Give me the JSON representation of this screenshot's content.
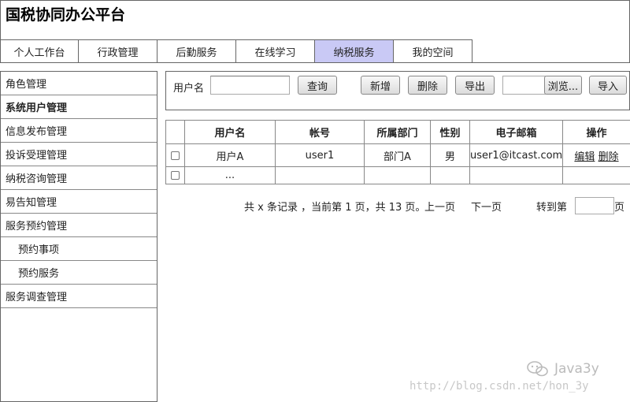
{
  "header": {
    "title": "国税协同办公平台"
  },
  "nav": {
    "tabs": [
      {
        "label": "个人工作台"
      },
      {
        "label": "行政管理"
      },
      {
        "label": "后勤服务"
      },
      {
        "label": "在线学习"
      },
      {
        "label": "纳税服务",
        "active": true
      },
      {
        "label": "我的空间"
      }
    ]
  },
  "sidebar": {
    "items": [
      {
        "label": "角色管理"
      },
      {
        "label": "系统用户管理",
        "active": true
      },
      {
        "label": "信息发布管理"
      },
      {
        "label": "投诉受理管理"
      },
      {
        "label": "纳税咨询管理"
      },
      {
        "label": "易告知管理"
      },
      {
        "label": "服务预约管理"
      },
      {
        "label": "预约事项",
        "sub": true
      },
      {
        "label": "预约服务",
        "sub": true
      },
      {
        "label": "服务调查管理"
      }
    ]
  },
  "search": {
    "label": "用户名",
    "value": "",
    "query_button": "查询",
    "add_button": "新增",
    "delete_button": "删除",
    "export_button": "导出",
    "browse_button": "浏览...",
    "import_button": "导入"
  },
  "table": {
    "headers": [
      "",
      "用户名",
      "帐号",
      "所属部门",
      "性别",
      "电子邮箱",
      "操作"
    ],
    "rows": [
      {
        "username": "用户A",
        "account": "user1",
        "dept": "部门A",
        "gender": "男",
        "email": "user1@itcast.com",
        "edit": "编辑",
        "delete": "删除"
      },
      {
        "username": "...",
        "account": "",
        "dept": "",
        "gender": "",
        "email": "",
        "edit": "",
        "delete": ""
      }
    ]
  },
  "pager": {
    "summary": "共 x 条记录 ，当前第 1 页，共 13 页。",
    "prev": "上一页",
    "next": "下一页",
    "goto_label": "转到第",
    "page_suffix": "页",
    "goto_value": ""
  },
  "watermark": {
    "url": "http://blog.csdn.net/hon_3y",
    "brand": "Java3y"
  },
  "colors": {
    "active_tab": "#c9c9f5",
    "border": "#666666"
  }
}
